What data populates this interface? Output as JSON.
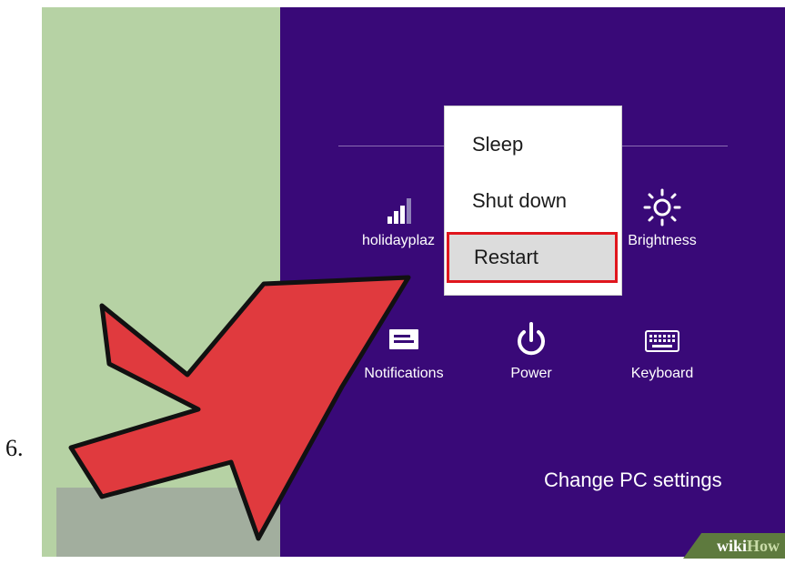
{
  "step": {
    "number": "6."
  },
  "power_menu": {
    "items": [
      {
        "label": "Sleep"
      },
      {
        "label": "Shut down"
      },
      {
        "label": "Restart",
        "highlighted": true
      }
    ]
  },
  "tiles": {
    "network": {
      "label": "holidayplaz",
      "icon": "wifi-signal-icon"
    },
    "brightness": {
      "label": "Brightness",
      "icon": "sun-icon"
    },
    "notifications": {
      "label": "Notifications",
      "icon": "notification-icon"
    },
    "power": {
      "label": "Power",
      "icon": "power-icon"
    },
    "keyboard": {
      "label": "Keyboard",
      "icon": "keyboard-icon"
    }
  },
  "footer": {
    "change_settings": "Change PC settings"
  },
  "watermark": {
    "prefix": "wiki",
    "suffix": "How"
  },
  "colors": {
    "charms_bg": "#390978",
    "desktop_bg": "#b6d2a4",
    "highlight_border": "#e0161d",
    "arrow_fill": "#e03a3e"
  }
}
